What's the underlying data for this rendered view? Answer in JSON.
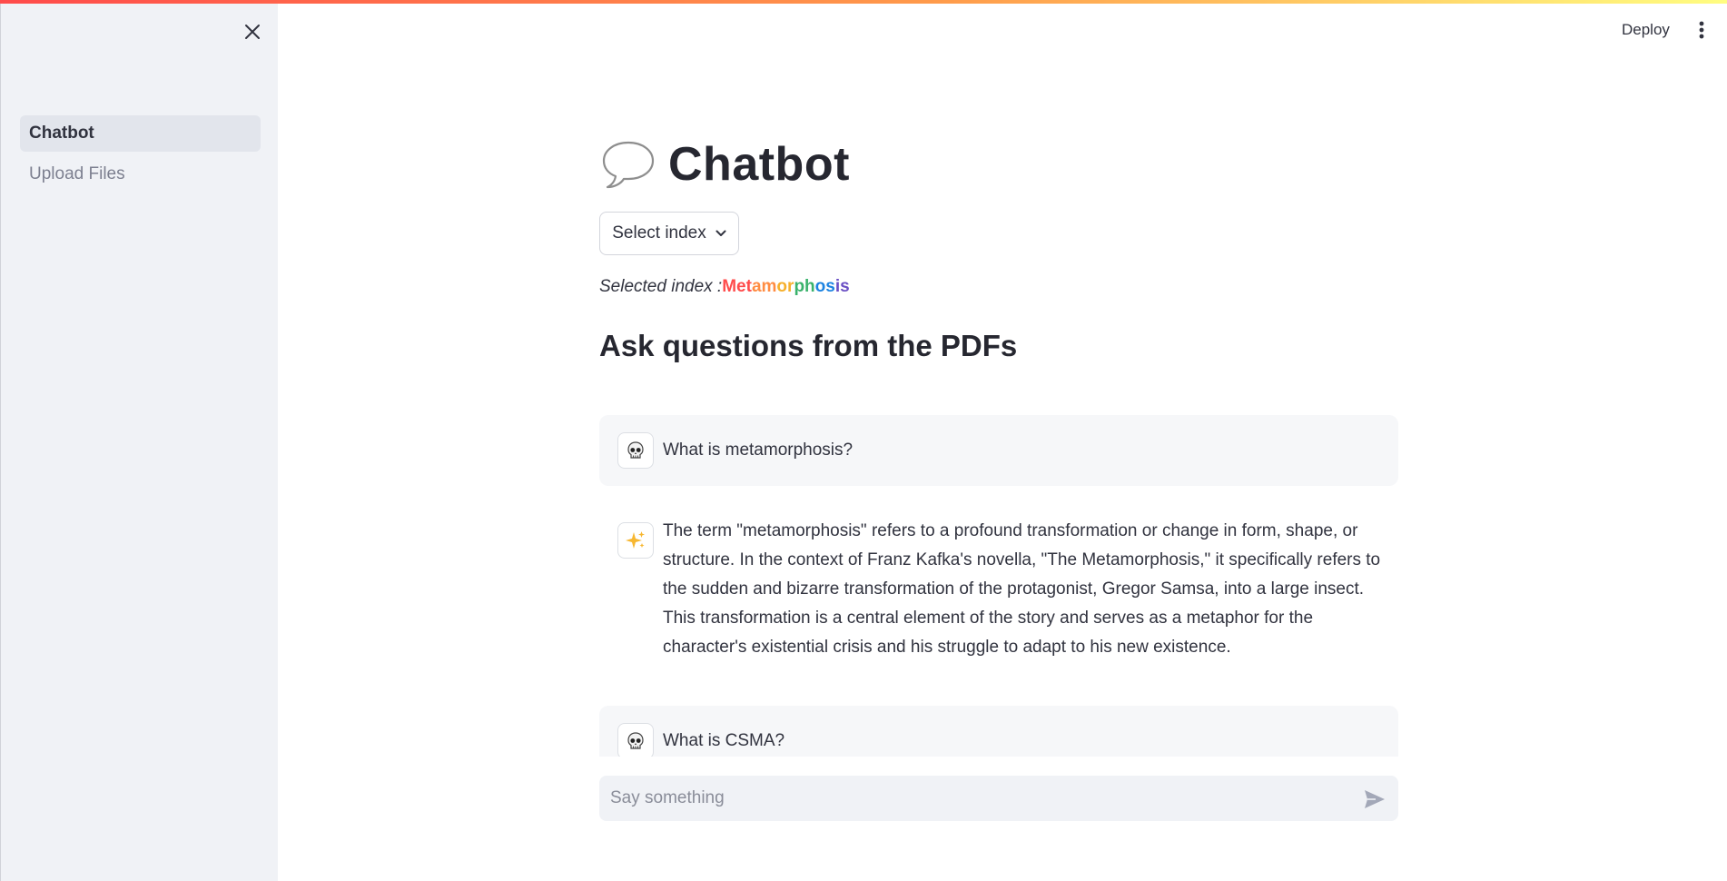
{
  "header": {
    "deploy_label": "Deploy",
    "menu_icon": "vertical-ellipsis-icon"
  },
  "sidebar": {
    "close_icon": "close-icon",
    "items": [
      {
        "label": "Chatbot",
        "active": true
      },
      {
        "label": "Upload Files",
        "active": false
      }
    ]
  },
  "main": {
    "title_icon": "speech-bubble-icon",
    "title": "Chatbot",
    "select_label": "Select index",
    "selected_prefix": "Selected index :",
    "selected_value": "Metamorphosis",
    "rainbow_colors": [
      "#ff4b4b",
      "#ff8c42",
      "#f6b02c",
      "#3ab26b",
      "#1c83e1",
      "#6a4fc4"
    ],
    "subheading": "Ask questions from the PDFs"
  },
  "messages": [
    {
      "role": "user",
      "avatar_icon": "skull-icon",
      "text": "What is metamorphosis?"
    },
    {
      "role": "assistant",
      "avatar_icon": "sparkles-icon",
      "text": "The term \"metamorphosis\" refers to a profound transformation or change in form, shape, or structure. In the context of Franz Kafka's novella, \"The Metamorphosis,\" it specifically refers to the sudden and bizarre transformation of the protagonist, Gregor Samsa, into a large insect. This transformation is a central element of the story and serves as a metaphor for the character's existential crisis and his struggle to adapt to his new existence."
    },
    {
      "role": "user",
      "avatar_icon": "skull-icon",
      "text": "What is CSMA?"
    }
  ],
  "chat_input": {
    "placeholder": "Say something",
    "value": "",
    "send_icon": "send-icon"
  },
  "colors": {
    "sidebar_bg": "#f0f2f6",
    "text": "#31333f",
    "user_msg_bg": "#f6f7f9",
    "accent": "#ff4b4b"
  }
}
